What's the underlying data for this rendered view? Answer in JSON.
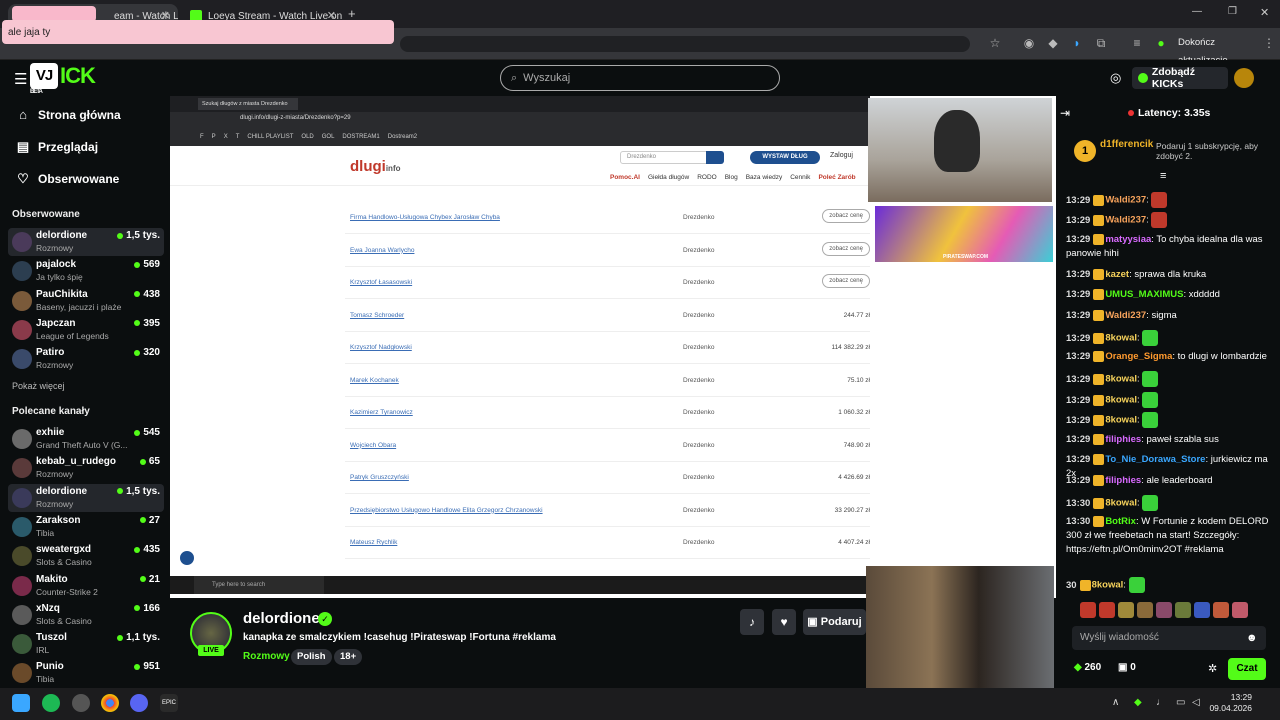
{
  "browser": {
    "tabs": [
      {
        "label": "eam - Watch Live"
      },
      {
        "label": "Loeya Stream - Watch Live on K"
      }
    ],
    "tooltip": "ale jaja ty",
    "finish_update": "Dokończ aktualizacje"
  },
  "kick": {
    "search_placeholder": "Wyszukaj",
    "get_kicks": "Zdobądź KICKs",
    "logo_text": "ICK",
    "logo_badge": "BETA"
  },
  "sidebar": {
    "nav": [
      {
        "label": "Strona główna",
        "icon": "home-icon"
      },
      {
        "label": "Przeglądaj",
        "icon": "browse-icon"
      },
      {
        "label": "Obserwowane",
        "icon": "heart-icon"
      }
    ],
    "followed_title": "Obserwowane",
    "followed": [
      {
        "name": "delordione",
        "category": "Rozmowy",
        "viewers": "1,5 tys."
      },
      {
        "name": "pajalock",
        "category": "Ja tylko śpię",
        "viewers": "569"
      },
      {
        "name": "PauChikita",
        "category": "Baseny, jacuzzi i plaże",
        "viewers": "438"
      },
      {
        "name": "Japczan",
        "category": "League of Legends",
        "viewers": "395"
      },
      {
        "name": "Patiro",
        "category": "Rozmowy",
        "viewers": "320"
      }
    ],
    "show_more": "Pokaż więcej",
    "recommended_title": "Polecane kanały",
    "recommended": [
      {
        "name": "exhiie",
        "category": "Grand Theft Auto V (G...",
        "viewers": "545"
      },
      {
        "name": "kebab_u_rudego",
        "category": "Rozmowy",
        "viewers": "65"
      },
      {
        "name": "delordione",
        "category": "Rozmowy",
        "viewers": "1,5 tys."
      },
      {
        "name": "Zarakson",
        "category": "Tibia",
        "viewers": "27"
      },
      {
        "name": "sweatergxd",
        "category": "Slots & Casino",
        "viewers": "435"
      },
      {
        "name": "Makito",
        "category": "Counter-Strike 2",
        "viewers": "21"
      },
      {
        "name": "xNzq",
        "category": "Slots & Casino",
        "viewers": "166"
      },
      {
        "name": "Tuszol",
        "category": "IRL",
        "viewers": "1,1 tys."
      },
      {
        "name": "Punio",
        "category": "Tibia",
        "viewers": "951"
      }
    ]
  },
  "stream_content": {
    "inner_tab": "Szukaj długów z miasta Drezdenko",
    "inner_url": "dlugi.info/dlugi-z-miasta/Drezdenko?p=29",
    "bookmarks": [
      "F",
      "P",
      "X",
      "T",
      "CHILL PLAYLIST",
      "OLD",
      "GOL",
      "DOSTREAM1",
      "Dostream2"
    ],
    "site_logo": "dlugi",
    "site_logo_suffix": "info",
    "site_search_value": "Drezdenko",
    "publish_button": "WYSTAW DŁUG",
    "login": "Zaloguj",
    "menu": [
      "Pomoc.AI",
      "Giełda długów",
      "RODO",
      "Blog",
      "Baza wiedzy",
      "Cennik",
      "Poleć Zarób"
    ],
    "rows": [
      {
        "name": "Firma Handlowo-Usługowa Chybex Jarosław Chyba",
        "city": "Drezdenko",
        "amount": "",
        "button": "zobacz cenę"
      },
      {
        "name": "Ewa Joanna Warlycho",
        "city": "Drezdenko",
        "amount": "",
        "button": "zobacz cenę"
      },
      {
        "name": "Krzysztof Łasasowski",
        "city": "Drezdenko",
        "amount": "",
        "button": "zobacz cenę"
      },
      {
        "name": "Tomasz Schroeder",
        "city": "Drezdenko",
        "amount": "244.77 zł",
        "button": ""
      },
      {
        "name": "Krzysztof Nadgłowski",
        "city": "Drezdenko",
        "amount": "114 382.29 zł",
        "button": ""
      },
      {
        "name": "Marek Kochanek",
        "city": "Drezdenko",
        "amount": "75.10 zł",
        "button": ""
      },
      {
        "name": "Kazimierz Tyranowicz",
        "city": "Drezdenko",
        "amount": "1 060.32 zł",
        "button": ""
      },
      {
        "name": "Wojciech Obara",
        "city": "Drezdenko",
        "amount": "748.90 zł",
        "button": ""
      },
      {
        "name": "Patryk Gruszczyński",
        "city": "Drezdenko",
        "amount": "4 426.69 zł",
        "button": ""
      },
      {
        "name": "Przedsiębiorstwo Usługowo Handlowe Elita Grzegorz Chrzanowski",
        "city": "Drezdenko",
        "amount": "33 290.27 zł",
        "button": ""
      },
      {
        "name": "Mateusz Rychlik",
        "city": "Drezdenko",
        "amount": "4 407.24 zł",
        "button": ""
      }
    ],
    "inner_search": "Type here to search",
    "pirate_banner": "PIRATESWAP.COM"
  },
  "stream": {
    "name": "delordione",
    "title": "kanapka ze smalczykiem !casehug !Pirateswap !Fortuna #reklama",
    "category": "Rozmowy",
    "tags": [
      "Polish",
      "18+"
    ],
    "live": "LIVE",
    "gift_label": "Podaruj"
  },
  "chat": {
    "latency": "Latency: 3.35s",
    "pinned_user": "d1fferencik",
    "pinned_text": "Podaruj 1 subskrypcję, aby zdobyć 2.",
    "messages": [
      {
        "time": "13:29",
        "user": "Waldi237",
        "text": "",
        "color": "#f7a35c"
      },
      {
        "time": "13:29",
        "user": "Waldi237",
        "text": "",
        "color": "#f7a35c"
      },
      {
        "time": "13:29",
        "user": "matyysiaa",
        "text": "To chyba idealna dla was panowie hihi",
        "color": "#d96bff"
      },
      {
        "time": "13:29",
        "user": "kazet",
        "text": "sprawa dla kruka",
        "color": "#f7d35c"
      },
      {
        "time": "13:29",
        "user": "UMUS_MAXIMUS",
        "text": "xddddd",
        "color": "#53fc18"
      },
      {
        "time": "13:29",
        "user": "Waldi237",
        "text": "sigma",
        "color": "#f7a35c"
      },
      {
        "time": "13:29",
        "user": "8kowal",
        "text": "",
        "color": "#f7d35c"
      },
      {
        "time": "13:29",
        "user": "Orange_Sigma",
        "text": "to dlugi w lombardzie",
        "color": "#ff9a2e"
      },
      {
        "time": "13:29",
        "user": "8kowal",
        "text": "",
        "color": "#f7d35c"
      },
      {
        "time": "13:29",
        "user": "8kowal",
        "text": "",
        "color": "#f7d35c"
      },
      {
        "time": "13:29",
        "user": "8kowal",
        "text": "",
        "color": "#f7d35c"
      },
      {
        "time": "13:29",
        "user": "filiphies",
        "text": "paweł szabla sus",
        "color": "#d96bff"
      },
      {
        "time": "13:29",
        "user": "To_Nie_Dorawa_Store",
        "text": "jurkiewicz ma 2x",
        "color": "#3aa7ff"
      },
      {
        "time": "13:29",
        "user": "filiphies",
        "text": "ale leaderboard",
        "color": "#d96bff"
      },
      {
        "time": "13:30",
        "user": "8kowal",
        "text": "",
        "color": "#f7d35c"
      },
      {
        "time": "13:30",
        "user": "BotRix",
        "text": "W Fortunie z kodem DELORD 300 zł we freebetach na start! Szczegóły: https://eftn.pl/Om0minv2OT #reklama",
        "color": "#53fc18"
      },
      {
        "time": "30",
        "user": "8kowal",
        "text": "",
        "color": "#f7d35c"
      }
    ],
    "input_placeholder": "Wyślij wiadomość",
    "kicks_count": "260",
    "gifts_count": "0",
    "send_label": "Czat"
  },
  "taskbar": {
    "time": "13:29",
    "date": "09.04.2026"
  }
}
